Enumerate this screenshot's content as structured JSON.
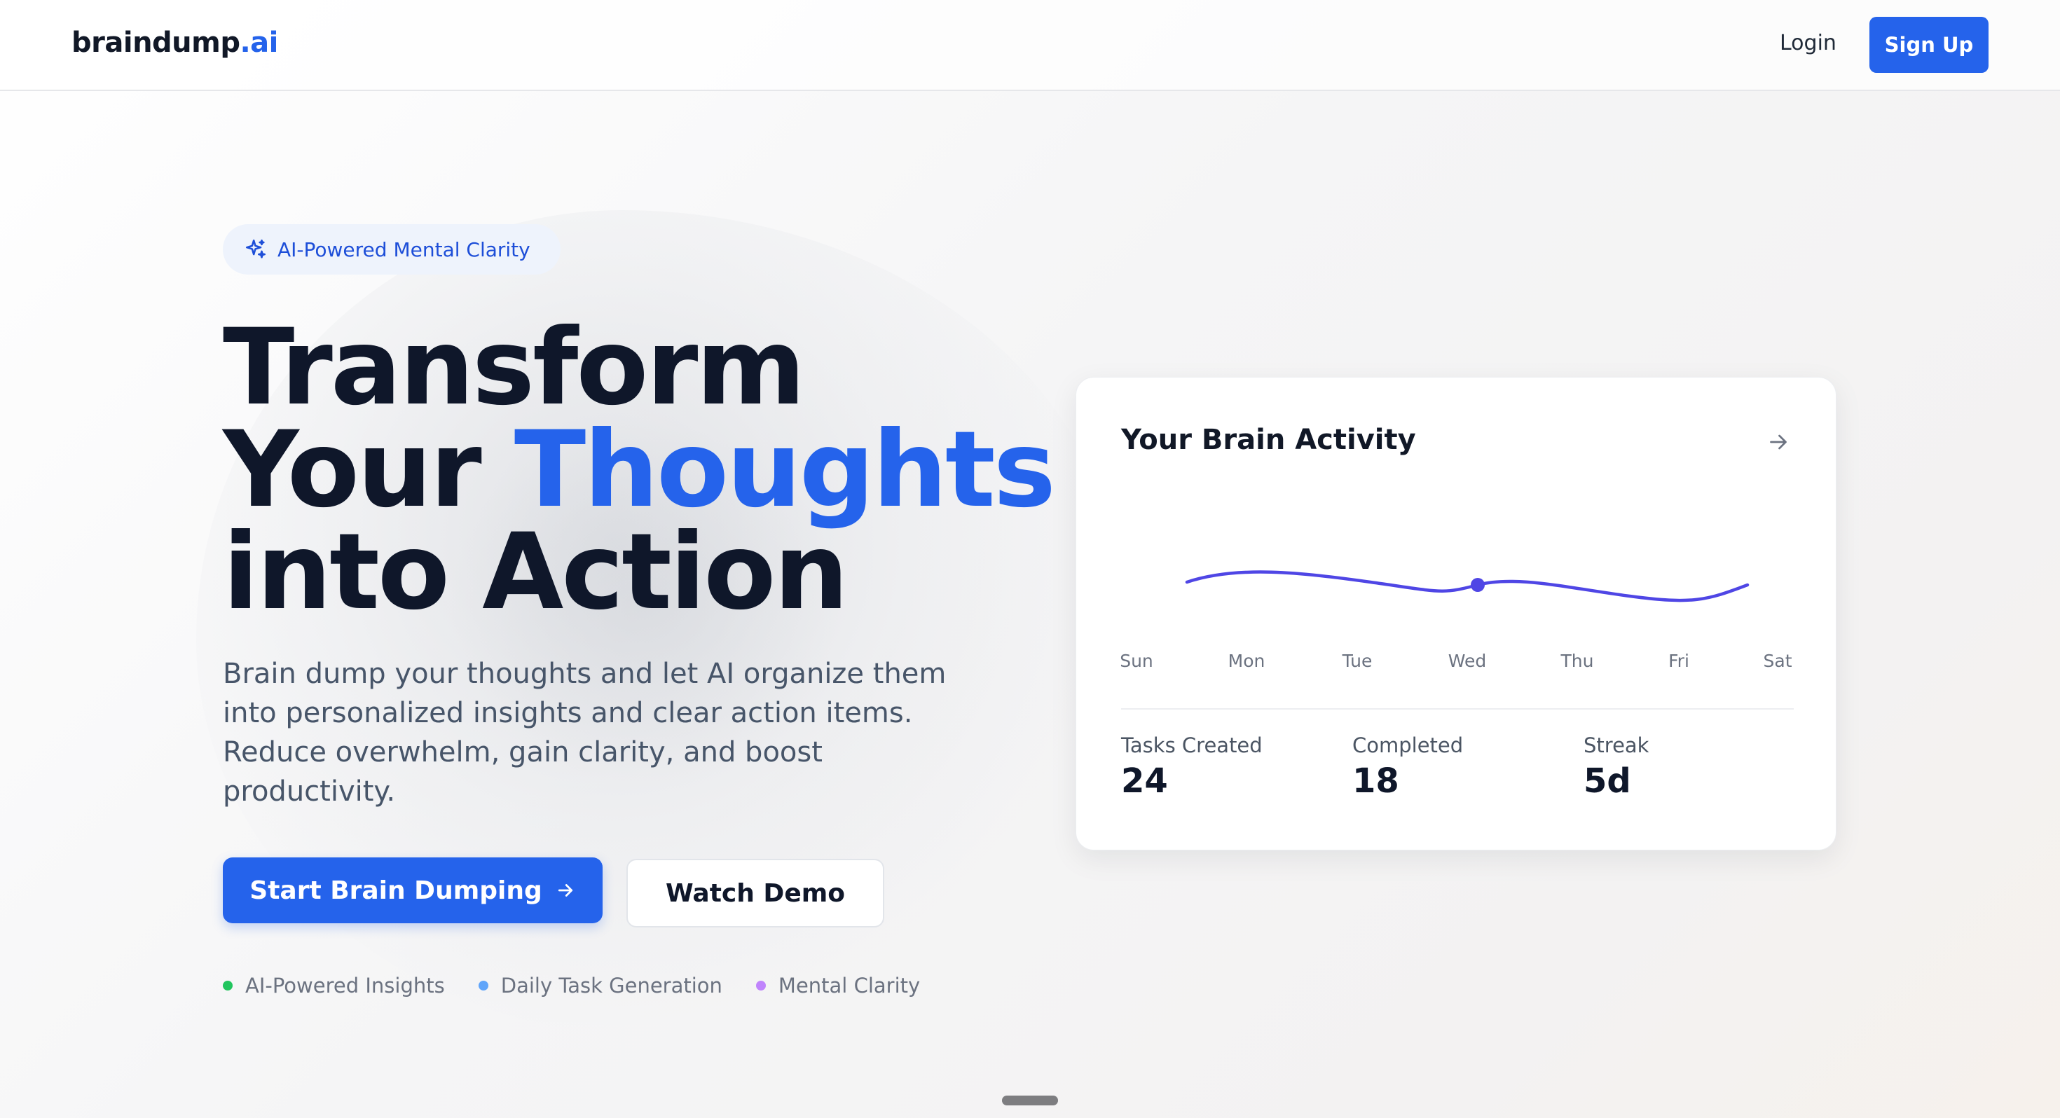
{
  "header": {
    "logo_main": "braindump",
    "logo_accent": ".ai",
    "login_label": "Login",
    "signup_label": "Sign Up"
  },
  "hero": {
    "badge": "AI-Powered Mental Clarity",
    "headline_line1": "Transform",
    "headline_line2_a": "Your ",
    "headline_line2_b": "Thoughts",
    "headline_line3": "into Action",
    "description": "Brain dump your thoughts and let AI organize them into personalized insights and clear action items. Reduce overwhelm, gain clarity, and boost productivity.",
    "primary_cta": "Start Brain Dumping",
    "secondary_cta": "Watch Demo",
    "features": [
      {
        "label": "AI-Powered Insights",
        "color": "#22c55e"
      },
      {
        "label": "Daily Task Generation",
        "color": "#3b82f6"
      },
      {
        "label": "Mental Clarity",
        "color": "#c084fc"
      }
    ]
  },
  "activity_card": {
    "title": "Your Brain Activity",
    "days": [
      "Sun",
      "Mon",
      "Tue",
      "Wed",
      "Thu",
      "Fri",
      "Sat"
    ],
    "stats": [
      {
        "label": "Tasks Created",
        "value": "24"
      },
      {
        "label": "Completed",
        "value": "18"
      },
      {
        "label": "Streak",
        "value": "5d"
      }
    ],
    "line_color": "#4f46e5"
  },
  "colors": {
    "brand_blue": "#2563eb",
    "text_dark": "#0f172a"
  }
}
